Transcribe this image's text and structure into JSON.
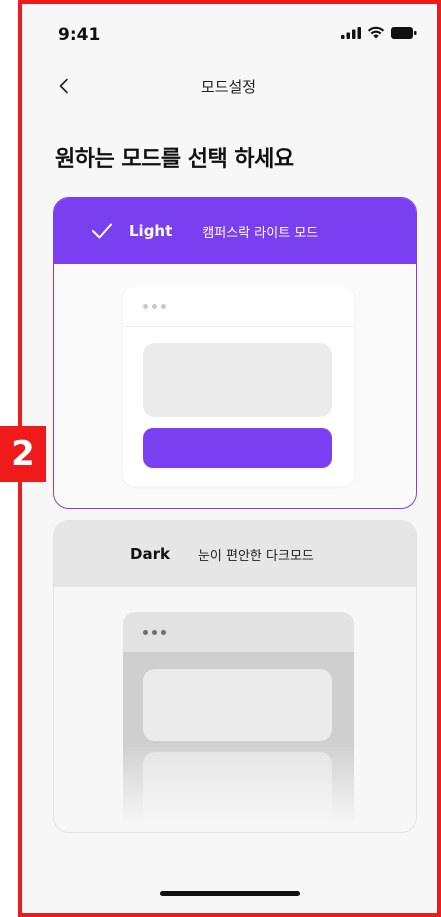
{
  "status_bar": {
    "time": "9:41"
  },
  "nav": {
    "title": "모드설정"
  },
  "heading": "원하는 모드를 선택 하세요",
  "modes": [
    {
      "name": "Light",
      "description": "캠퍼스락 라이트 모드",
      "selected": true,
      "accent": "#7B3FF2"
    },
    {
      "name": "Dark",
      "description": "눈이 편안한 다크모드",
      "selected": false
    }
  ],
  "annotation": {
    "label": "2",
    "color": "#EF1A1A"
  }
}
